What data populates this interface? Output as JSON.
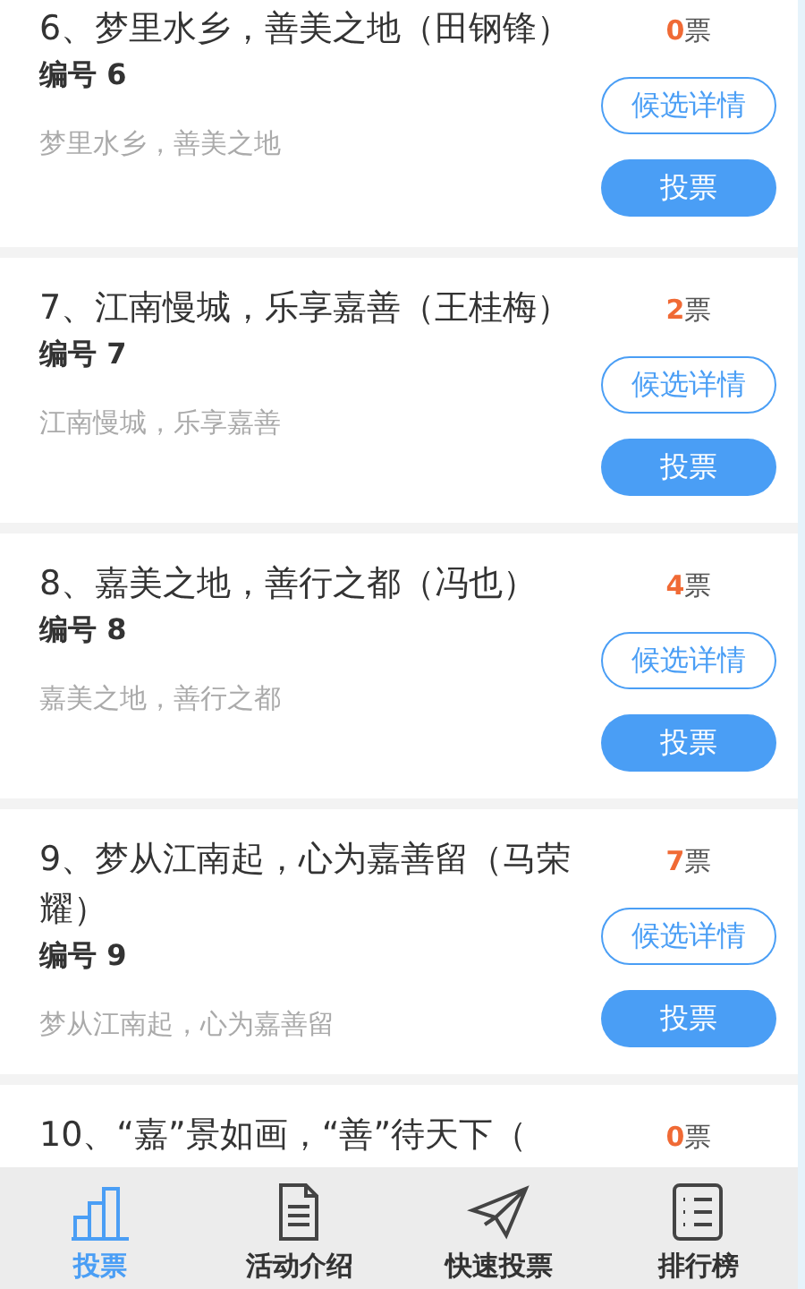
{
  "candidates": [
    {
      "title": "6、梦里水乡，善美之地（田钢锋）",
      "number": "编号 6",
      "slogan": "梦里水乡，善美之地",
      "votes": "0",
      "votes_unit": "票",
      "details_button": "候选详情",
      "vote_button": "投票"
    },
    {
      "title": "7、江南慢城，乐享嘉善（王桂梅）",
      "number": "编号 7",
      "slogan": "江南慢城，乐享嘉善",
      "votes": "2",
      "votes_unit": "票",
      "details_button": "候选详情",
      "vote_button": "投票"
    },
    {
      "title": "8、嘉美之地，善行之都（冯也）",
      "number": "编号 8",
      "slogan": "嘉美之地，善行之都",
      "votes": "4",
      "votes_unit": "票",
      "details_button": "候选详情",
      "vote_button": "投票"
    },
    {
      "title": "9、梦从江南起，心为嘉善留（马荣耀）",
      "number": "编号 9",
      "slogan": "梦从江南起，心为嘉善留",
      "votes": "7",
      "votes_unit": "票",
      "details_button": "候选详情",
      "vote_button": "投票"
    },
    {
      "title": "10、“嘉”景如画，“善”待天下（",
      "votes": "0",
      "votes_unit": "票"
    }
  ],
  "tab_bar": [
    {
      "kind": "chart",
      "label": "投票",
      "selected": true
    },
    {
      "kind": "document",
      "label": "活动介绍",
      "selected": false
    },
    {
      "kind": "plane",
      "label": "快速投票",
      "selected": false
    },
    {
      "kind": "ranking",
      "label": "排行榜",
      "selected": false
    }
  ]
}
